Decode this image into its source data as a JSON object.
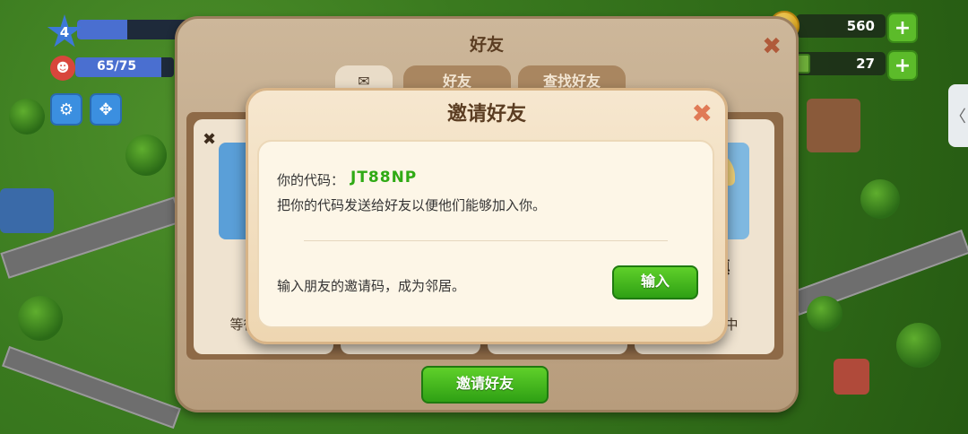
{
  "hud": {
    "level": "4",
    "xp_progress": 0.35,
    "population": "65/75",
    "population_progress": 0.87,
    "coins": "560",
    "cash": "27",
    "settings_icon": "gear-icon",
    "move_icon": "move-arrows-icon"
  },
  "friends_panel": {
    "title": "好友",
    "tabs": [
      {
        "label": "",
        "icon": "mail-icon"
      },
      {
        "label": "好友"
      },
      {
        "label": "查找好友"
      }
    ],
    "cards": [
      {
        "name": "",
        "status": "等待回复中"
      },
      {
        "name": "",
        "status": ""
      },
      {
        "name": "",
        "status": ""
      },
      {
        "name": "思城镇",
        "status": "等待回复中"
      }
    ],
    "invite_button_label": "邀请好友"
  },
  "invite_dialog": {
    "title": "邀请好友",
    "code_label": "你的代码：",
    "code_value": "JT88NP",
    "description": "把你的代码发送给好友以便他们能够加入你。",
    "enter_prompt": "输入朋友的邀请码，成为邻居。",
    "enter_button_label": "输入"
  },
  "side_tab_label": "〈",
  "colors": {
    "accent_green": "#2faa14",
    "dialog_bg": "#f6e7cf"
  }
}
